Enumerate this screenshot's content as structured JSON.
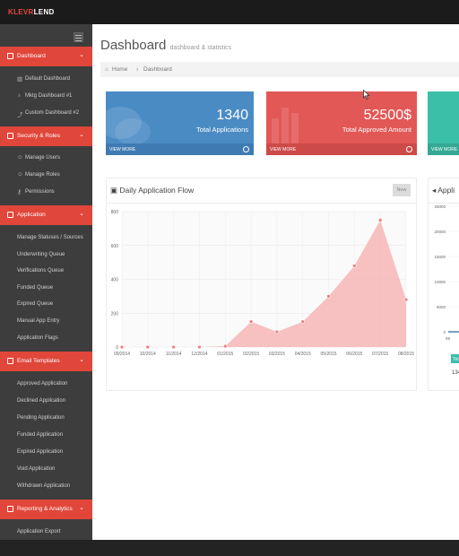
{
  "app": {
    "logo_part1": "KLEVR",
    "logo_part2": "LEND"
  },
  "sidebar": {
    "sections": [
      {
        "label": "Dashboard",
        "items": [
          {
            "label": "Default Dashboard",
            "icon": "bar-chart-icon"
          },
          {
            "label": "Mktg Dashboard #1",
            "icon": "map-pin-icon"
          },
          {
            "label": "Custom Dashboard #2",
            "icon": "trend-line-icon"
          }
        ]
      },
      {
        "label": "Security & Roles",
        "items": [
          {
            "label": "Manage Users",
            "icon": "users-icon"
          },
          {
            "label": "Manage Roles",
            "icon": "roles-icon"
          },
          {
            "label": "Permissions",
            "icon": "key-icon"
          }
        ]
      },
      {
        "label": "Application",
        "items": [
          {
            "label": "Manage Statuses / Sources"
          },
          {
            "label": "Underwriting Queue"
          },
          {
            "label": "Verifications Queue"
          },
          {
            "label": "Funded Queue"
          },
          {
            "label": "Expired Queue"
          },
          {
            "label": "Manual App Entry"
          },
          {
            "label": "Application Flags"
          }
        ]
      },
      {
        "label": "Email Templates",
        "items": [
          {
            "label": "Approved Application"
          },
          {
            "label": "Declined Application"
          },
          {
            "label": "Pending Application"
          },
          {
            "label": "Funded Application"
          },
          {
            "label": "Expired Application"
          },
          {
            "label": "Void Application"
          },
          {
            "label": "Withdrawn Application"
          }
        ]
      },
      {
        "label": "Reporting & Analytics",
        "items": [
          {
            "label": "Application Export"
          }
        ]
      }
    ]
  },
  "header": {
    "title": "Dashboard",
    "subtitle": "dashboard & statistics"
  },
  "breadcrumb": {
    "home": "Home",
    "current": "Dashboard"
  },
  "tiles": [
    {
      "value": "1340",
      "caption": "Total Applications",
      "more": "VIEW MORE",
      "color": "#4a8bc4"
    },
    {
      "value": "52500$",
      "caption": "Total Approved Amount",
      "more": "VIEW MORE",
      "color": "#e25856"
    },
    {
      "value": "",
      "caption": "",
      "more": "VIEW MORE",
      "color": "#3cbfa8"
    }
  ],
  "panels": {
    "flow": {
      "title": "Daily Application Flow",
      "button": "New"
    },
    "second": {
      "title": "Appli",
      "legend_badge": "Tot",
      "legend_value": "134"
    }
  },
  "chart_data": [
    {
      "type": "area",
      "title": "Daily Application Flow",
      "categories": [
        "09/2014",
        "10/2014",
        "11/2014",
        "12/2014",
        "01/2015",
        "02/2015",
        "03/2015",
        "04/2015",
        "05/2015",
        "06/2015",
        "07/2015",
        "08/2015"
      ],
      "values": [
        0,
        0,
        0,
        0,
        5,
        150,
        90,
        150,
        300,
        480,
        750,
        280
      ],
      "ylim": [
        0,
        800
      ],
      "yticks": [
        0,
        200,
        400,
        600,
        800
      ],
      "grid": true,
      "color": "#f6b6b6",
      "point_color": "#f07f7f"
    },
    {
      "type": "bar",
      "yticks": [
        0,
        5000,
        10000,
        15000,
        20000,
        25000
      ],
      "ylim": [
        0,
        25000
      ],
      "categories": [
        "59"
      ],
      "grid": true
    }
  ]
}
